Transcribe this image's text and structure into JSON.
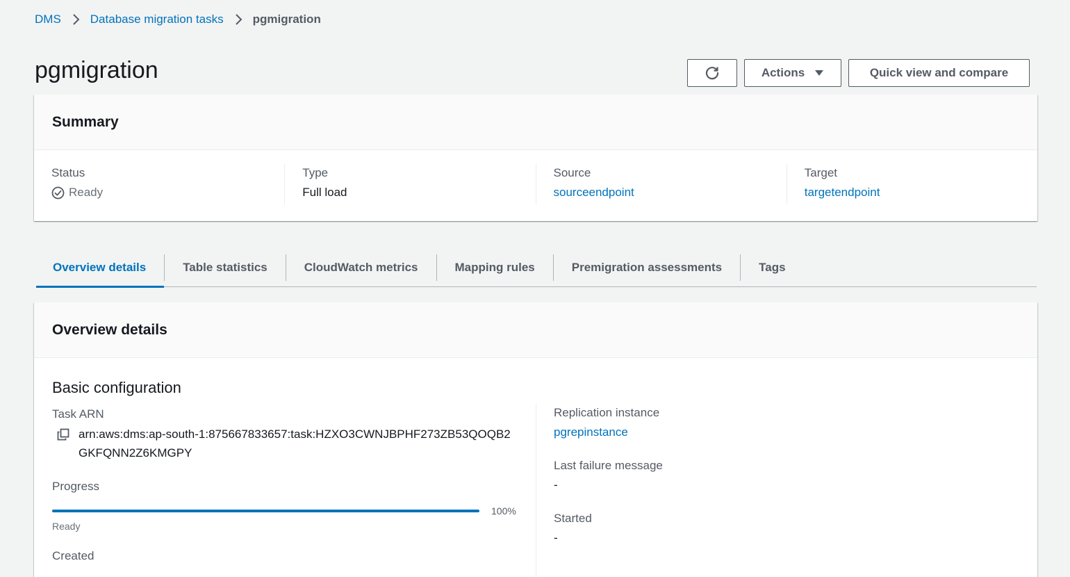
{
  "breadcrumb": {
    "items": [
      "DMS",
      "Database migration tasks"
    ],
    "current": "pgmigration"
  },
  "header": {
    "title": "pgmigration",
    "actions_label": "Actions",
    "quick_view_label": "Quick view and compare"
  },
  "summary": {
    "title": "Summary",
    "status_label": "Status",
    "status_value": "Ready",
    "type_label": "Type",
    "type_value": "Full load",
    "source_label": "Source",
    "source_value": "sourceendpoint",
    "target_label": "Target",
    "target_value": "targetendpoint"
  },
  "tabs": [
    {
      "label": "Overview details",
      "active": true
    },
    {
      "label": "Table statistics",
      "active": false
    },
    {
      "label": "CloudWatch metrics",
      "active": false
    },
    {
      "label": "Mapping rules",
      "active": false
    },
    {
      "label": "Premigration assessments",
      "active": false
    },
    {
      "label": "Tags",
      "active": false
    }
  ],
  "overview": {
    "title": "Overview details",
    "section_title": "Basic configuration",
    "task_arn_label": "Task ARN",
    "task_arn_value": "arn:aws:dms:ap-south-1:875667833657:task:HZXO3CWNJBPHF273ZB53QOQB2GKFQNN2Z6KMGPY",
    "progress_label": "Progress",
    "progress_percent": "100%",
    "progress_fraction": 1.0,
    "progress_status": "Ready",
    "created_label": "Created",
    "replication_instance_label": "Replication instance",
    "replication_instance_value": "pgrepinstance",
    "last_failure_label": "Last failure message",
    "last_failure_value": "-",
    "started_label": "Started",
    "started_value": "-"
  },
  "colors": {
    "link": "#0073bb",
    "text": "#16191f",
    "muted": "#545b64",
    "background": "#f2f3f3"
  },
  "icons": {
    "refresh": "refresh-icon",
    "dropdown": "caret-down-icon",
    "status": "check-circle-icon",
    "copy": "copy-icon",
    "breadcrumb_separator": "chevron-right-icon"
  }
}
